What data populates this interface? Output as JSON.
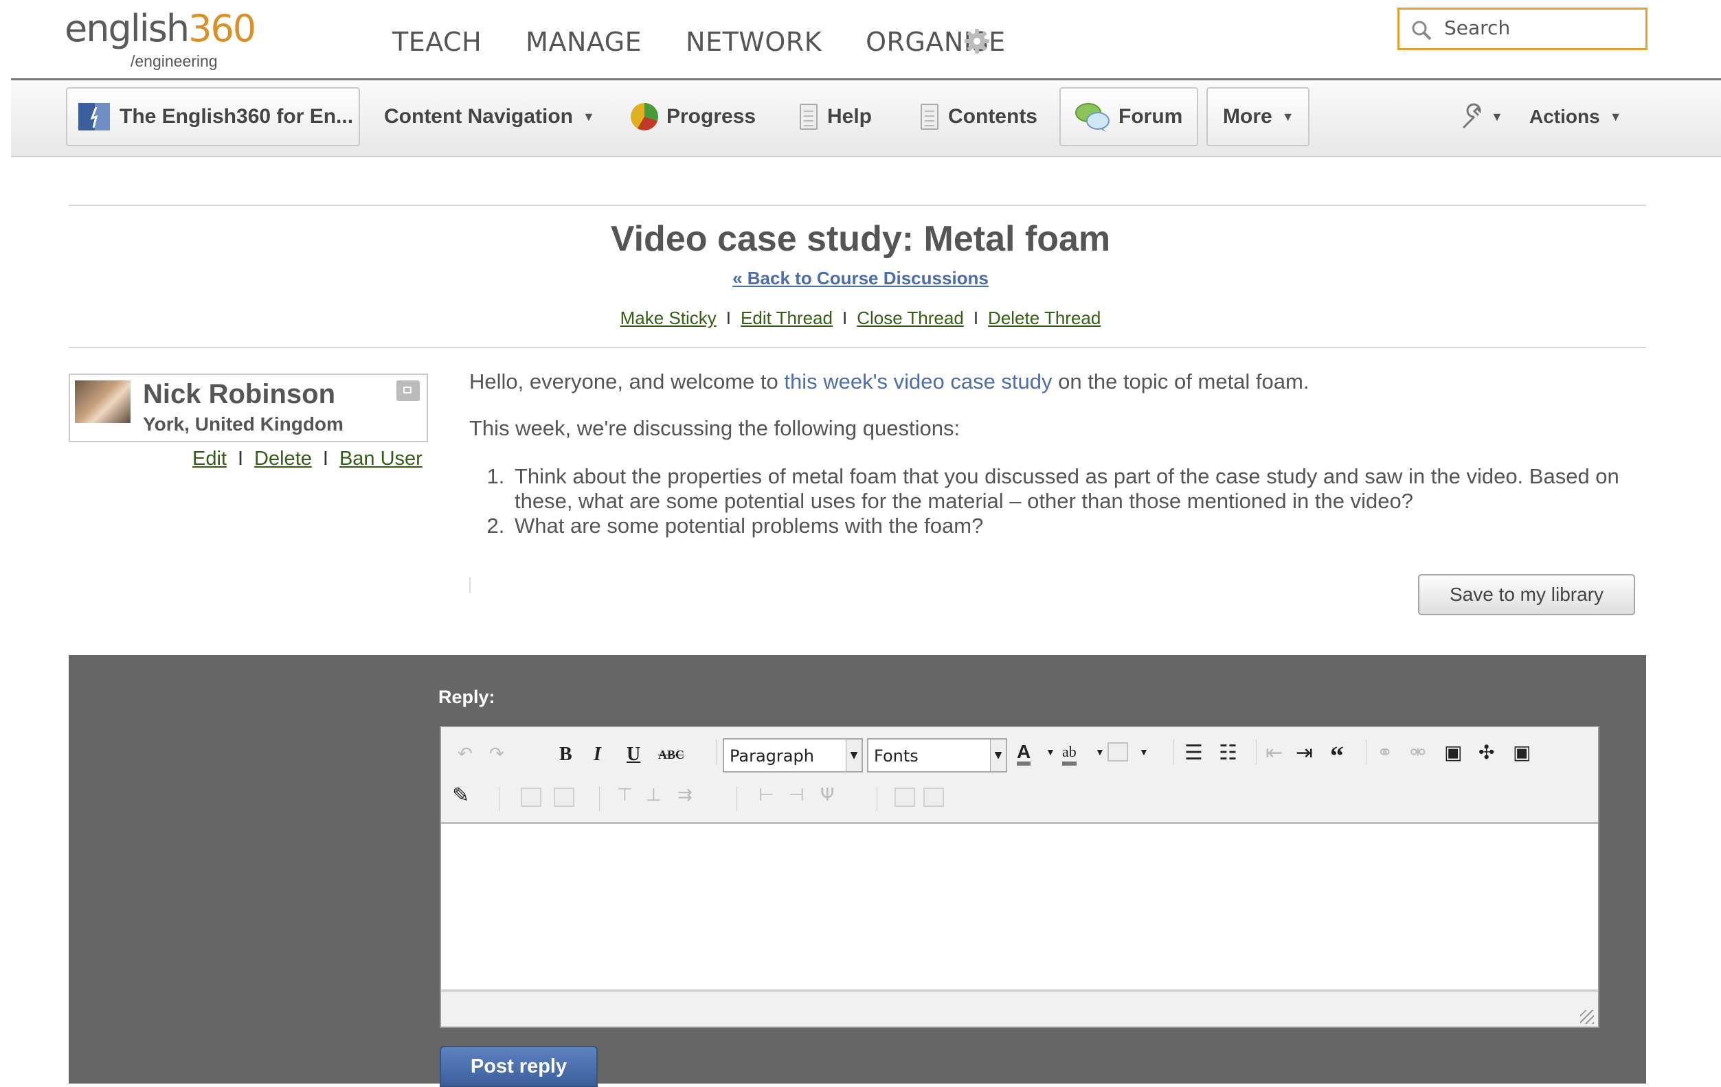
{
  "logo": {
    "word_main": "english",
    "word_num": "360",
    "sub": "/engineering"
  },
  "topnav": {
    "items": [
      "TEACH",
      "MANAGE",
      "NETWORK",
      "ORGANISE"
    ]
  },
  "search": {
    "placeholder": "Search"
  },
  "toolbar": {
    "course": "The English360 for En...",
    "content_navigation": "Content Navigation",
    "progress": "Progress",
    "help": "Help",
    "contents": "Contents",
    "forum": "Forum",
    "more": "More",
    "actions": "Actions"
  },
  "thread": {
    "title": "Video case study: Metal foam",
    "back_link": "« Back to Course Discussions",
    "actions": [
      "Make Sticky",
      "Edit Thread",
      "Close Thread",
      "Delete Thread"
    ]
  },
  "author": {
    "name": "Nick Robinson",
    "location": "York, United Kingdom",
    "links": [
      "Edit",
      "Delete",
      "Ban User"
    ]
  },
  "post": {
    "intro_before": "Hello, everyone, and welcome to ",
    "intro_link": "this week's video case study",
    "intro_after": " on the topic of metal foam.",
    "line2": "This week, we're discussing the following questions:",
    "questions": [
      "Think about the properties of metal foam that you discussed as part of the case study and saw in the video. Based on these, what are some potential uses for the material – other than those mentioned in the video?",
      "What are some potential problems with the foam?"
    ],
    "save_button": "Save to my library"
  },
  "reply": {
    "label": "Reply:",
    "format_select": "Paragraph",
    "font_select": "Fonts",
    "post_button": "Post reply"
  },
  "colors": {
    "accent": "#e2a233",
    "link": "#4c6ea7",
    "link_green": "#345d15",
    "panel": "#666666"
  }
}
